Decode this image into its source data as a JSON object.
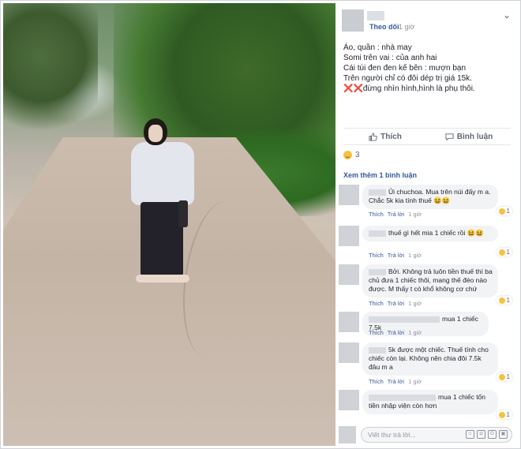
{
  "post": {
    "follow_label": "Theo dõi",
    "time_label": "1 giờ",
    "menu_label": "⌄",
    "caption_lines": [
      "Áo, quần : nhà may",
      "Somi trên vai : của anh hai",
      "Cái túi đen đen kế bên : mượn bạn",
      "Trên người chỉ có đôi dép trị giá 15k.",
      "đừng nhìn hình,hình là phụ thôi."
    ],
    "caption_x_marks": "❌❌"
  },
  "actions": {
    "like_label": "Thích",
    "comment_label": "Bình luận"
  },
  "reactions": {
    "count": "3"
  },
  "more_comments_label": "Xem thêm 1 bình luận",
  "comments": [
    {
      "text": "Ủi chuchoa. Mua trên núi đấy m a. Chắc 5k kia tính thuế 😆😆",
      "like": "Thích",
      "reply": "Trả lời",
      "time": "1 giờ",
      "react_count": "1"
    },
    {
      "text": "thuế gì hết mia 1 chiếc rồi 😆😆",
      "like": "Thích",
      "reply": "Trả lời",
      "time": "1 giờ",
      "react_count": "1"
    },
    {
      "text": "Bởi. Không trả luôn tiền thuế thì ba chủ đưa 1 chiếc thôi, mang thế đéo nào được. M thấy t có khổ không cơ chứ",
      "like": "Thích",
      "reply": "Trả lời",
      "time": "1 giờ",
      "react_count": "1"
    },
    {
      "text": "mua 1 chiếc 7.5k",
      "like": "Thích",
      "reply": "Trả lời",
      "time": "1 giờ",
      "react_count": ""
    },
    {
      "text": "5k được một chiếc. Thuế tính cho chiếc còn lại. Không nên chia đôi 7.5k đâu m a",
      "like": "Thích",
      "reply": "Trả lời",
      "time": "1 giờ",
      "react_count": "1"
    },
    {
      "text": "mua 1 chiếc tốn tiền nhập viện còn hơn",
      "like": "Thích",
      "reply": "Trả lời",
      "time": "1 giờ",
      "react_count": "1"
    }
  ],
  "write_comment": {
    "placeholder": "Viết thư trả lời..."
  },
  "colors": {
    "link": "#365899",
    "emoji": "#f7c23e",
    "red_x": "#d0021b"
  }
}
